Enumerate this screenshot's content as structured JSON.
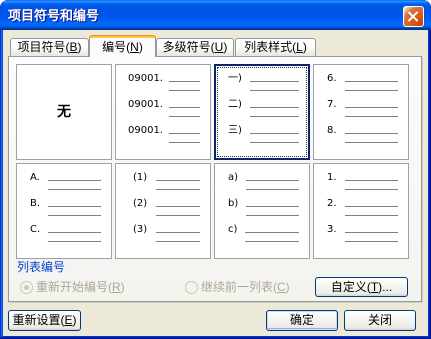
{
  "window": {
    "title": "项目符号和编号",
    "close_icon": "close-icon"
  },
  "tabs": [
    {
      "label": "项目符号(B)",
      "active": false
    },
    {
      "label": "编号(N)",
      "active": true
    },
    {
      "label": "多级符号(U)",
      "active": false
    },
    {
      "label": "列表样式(L)",
      "active": false
    }
  ],
  "gallery": {
    "cells": [
      {
        "text": "无"
      },
      {
        "items": [
          "09001.",
          "09001.",
          "09001."
        ]
      },
      {
        "items": [
          "一)",
          "二)",
          "三)"
        ],
        "selected": true
      },
      {
        "items": [
          "6.",
          "7.",
          "8."
        ]
      },
      {
        "items": [
          "A.",
          "B.",
          "C."
        ]
      },
      {
        "items": [
          "(1)",
          "(2)",
          "(3)"
        ]
      },
      {
        "items": [
          "a)",
          "b)",
          "c)"
        ]
      },
      {
        "items": [
          "1.",
          "2.",
          "3."
        ]
      }
    ]
  },
  "list_numbering": {
    "label": "列表编号",
    "options": [
      {
        "label": "重新开始编号(R)",
        "checked": true,
        "disabled": true
      },
      {
        "label": "继续前一列表(C)",
        "checked": false,
        "disabled": true
      }
    ],
    "customize_button": "自定义(T)..."
  },
  "footer": {
    "reset_button": "重新设置(E)",
    "ok_button": "确定",
    "close_button": "关闭"
  },
  "colors": {
    "title_bar": "#0054E3",
    "dialog_background": "#ECE9D8",
    "group_label": "#0046D5",
    "disabled_text": "#ACA899",
    "selection_border": "#0A246A",
    "close_button": "#DC6527"
  }
}
